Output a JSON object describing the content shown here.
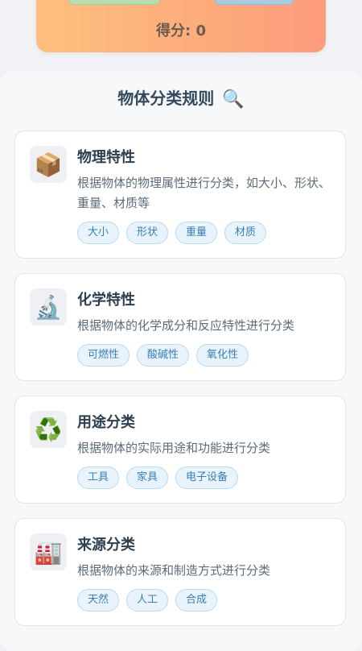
{
  "game": {
    "score_text": "得分: 0"
  },
  "panel": {
    "title": "物体分类规则",
    "title_icon": "magnifier-icon"
  },
  "rules": [
    {
      "icon": "package-icon",
      "title": "物理特性",
      "desc": "根据物体的物理属性进行分类，如大小、形状、重量、材质等",
      "tags": [
        "大小",
        "形状",
        "重量",
        "材质"
      ]
    },
    {
      "icon": "microscope-icon",
      "title": "化学特性",
      "desc": "根据物体的化学成分和反应特性进行分类",
      "tags": [
        "可燃性",
        "酸碱性",
        "氧化性"
      ]
    },
    {
      "icon": "recycle-icon",
      "title": "用途分类",
      "desc": "根据物体的实际用途和功能进行分类",
      "tags": [
        "工具",
        "家具",
        "电子设备"
      ]
    },
    {
      "icon": "factory-icon",
      "title": "来源分类",
      "desc": "根据物体的来源和制造方式进行分类",
      "tags": [
        "天然",
        "人工",
        "合成"
      ]
    }
  ]
}
